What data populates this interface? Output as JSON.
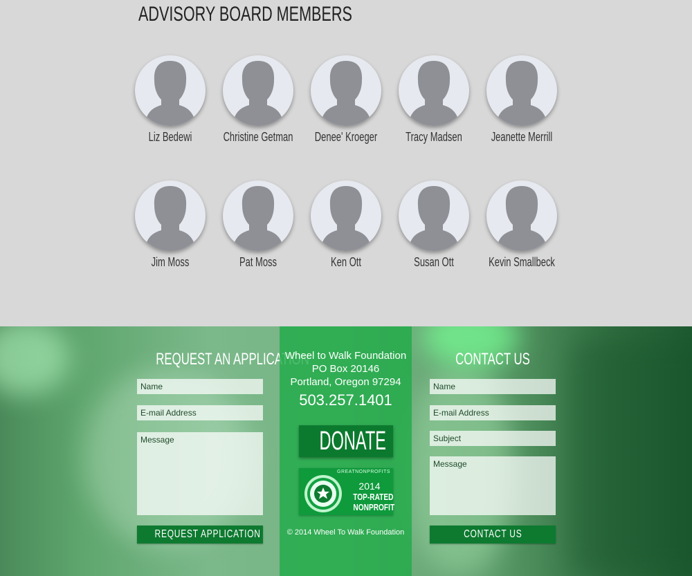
{
  "advisory": {
    "title": "ADVISORY BOARD MEMBERS",
    "members": [
      {
        "name": "Liz Bedewi"
      },
      {
        "name": "Christine Getman"
      },
      {
        "name": "Denee' Kroeger"
      },
      {
        "name": "Tracy Madsen"
      },
      {
        "name": "Jeanette Merrill"
      },
      {
        "name": "Jim Moss"
      },
      {
        "name": "Pat Moss"
      },
      {
        "name": "Ken Ott"
      },
      {
        "name": "Susan Ott"
      },
      {
        "name": "Kevin Smallbeck"
      }
    ]
  },
  "request": {
    "title": "REQUEST AN APPLICATION",
    "name_placeholder": "Name",
    "email_placeholder": "E-mail Address",
    "message_placeholder": "Message",
    "button_label": "REQUEST APPLICATION"
  },
  "center": {
    "org_name": "Wheel to Walk Foundation",
    "po_box": "PO Box 20146",
    "city": "Portland, Oregon 97294",
    "phone": "503.257.1401",
    "donate_label": "DONATE",
    "badge": {
      "brand": "GREATNONPROFITS",
      "year": "2014",
      "line1": "TOP-RATED",
      "line2": "NONPROFIT"
    },
    "copyright": "© 2014 Wheel To Walk Foundation"
  },
  "contact": {
    "title": "CONTACT US",
    "name_placeholder": "Name",
    "email_placeholder": "E-mail Address",
    "subject_placeholder": "Subject",
    "message_placeholder": "Message",
    "button_label": "CONTACT US"
  },
  "colors": {
    "accent_green": "#0d7a30",
    "center_green": "#1eaa46"
  }
}
